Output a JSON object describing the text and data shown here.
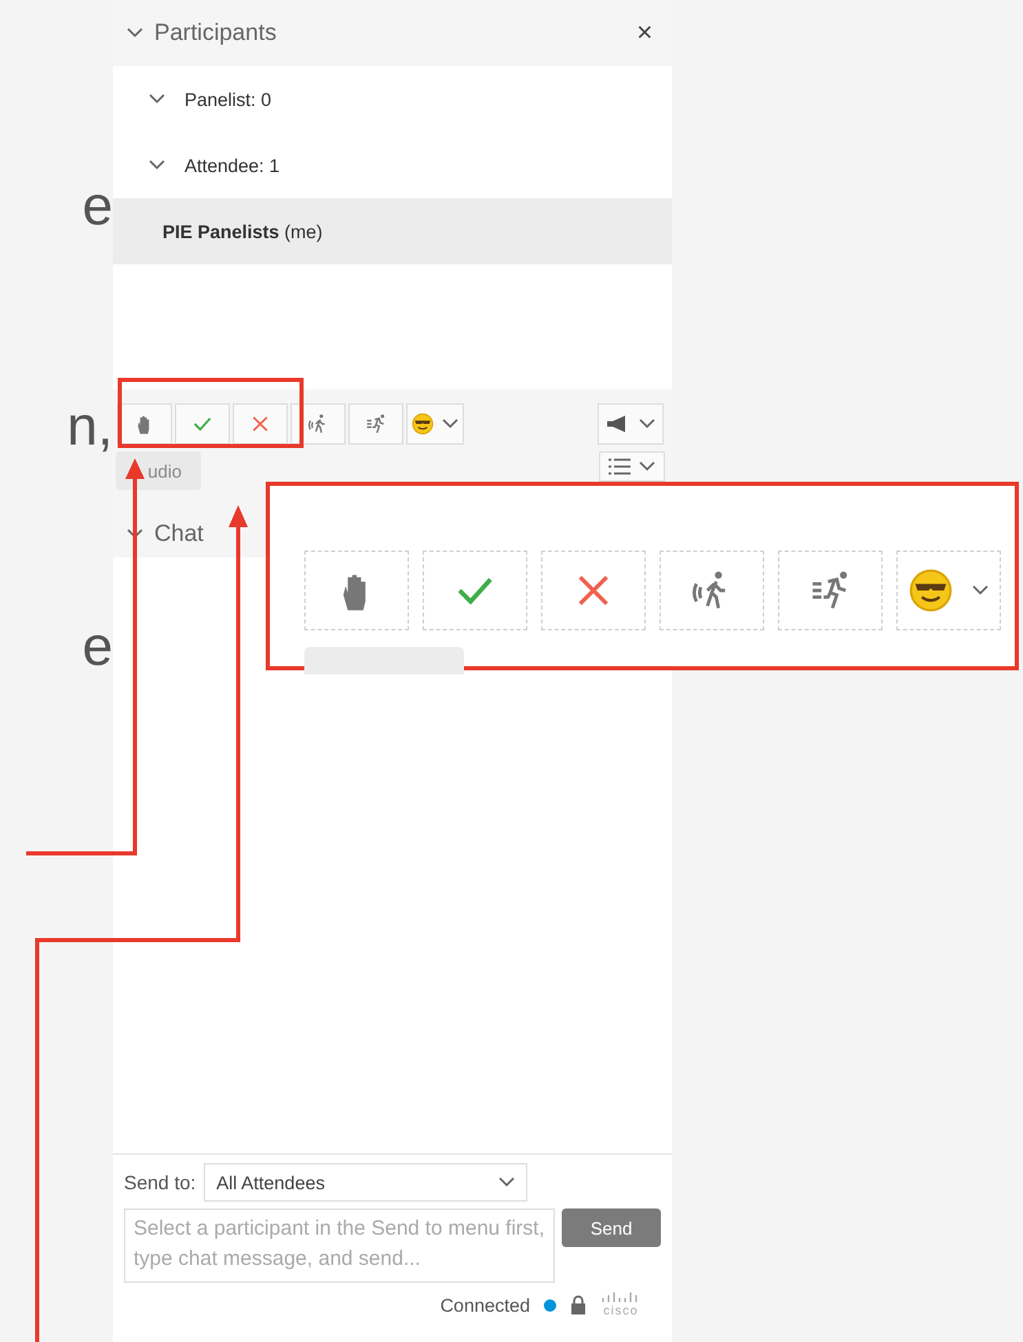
{
  "slide_fragments": [
    "e",
    "n,",
    "e"
  ],
  "participants_panel": {
    "title": "Participants",
    "expanded": true,
    "close_button": "×",
    "items": [
      {
        "label": "Panelist: 0",
        "kind": "group",
        "selected": false
      },
      {
        "label": "Attendee: 1",
        "kind": "group",
        "selected": false
      },
      {
        "label": "**PIE Panelists** (me)",
        "kind": "person",
        "selected": true
      }
    ],
    "reactions": [
      {
        "kind": "hand"
      },
      {
        "kind": "check"
      },
      {
        "kind": "cross"
      },
      {
        "kind": "walk"
      },
      {
        "kind": "run"
      },
      {
        "kind": "emoji"
      }
    ],
    "audio_button": "udio"
  },
  "chat_panel": {
    "title": "Chat",
    "expanded": true,
    "send_to_label": "Send to:",
    "send_to_value": "All Attendees",
    "message_placeholder": "Select a participant in the Send to menu first, type chat message, and send...",
    "send_button": "Send",
    "status": "Connected",
    "logo_text": "cisco"
  }
}
